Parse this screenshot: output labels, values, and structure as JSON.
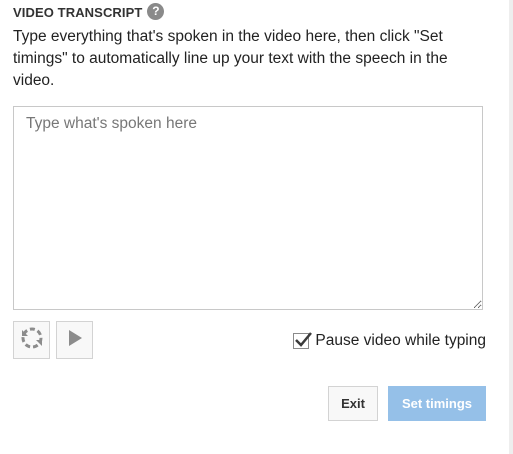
{
  "section": {
    "title": "VIDEO TRANSCRIPT",
    "help_icon": "?"
  },
  "instructions": "Type everything that's spoken in the video here, then click \"Set timings\" to automatically line up your text with the speech in the video.",
  "transcript": {
    "value": "",
    "placeholder": "Type what's spoken here"
  },
  "controls": {
    "replay_icon": "replay-icon",
    "play_icon": "play-icon"
  },
  "pause_option": {
    "label": "Pause video while typing",
    "checked": true
  },
  "actions": {
    "exit_label": "Exit",
    "set_timings_label": "Set timings"
  },
  "colors": {
    "primary_disabled": "#95c0e8",
    "help_icon_bg": "#8a8a8a",
    "border": "#c8c8c8"
  }
}
